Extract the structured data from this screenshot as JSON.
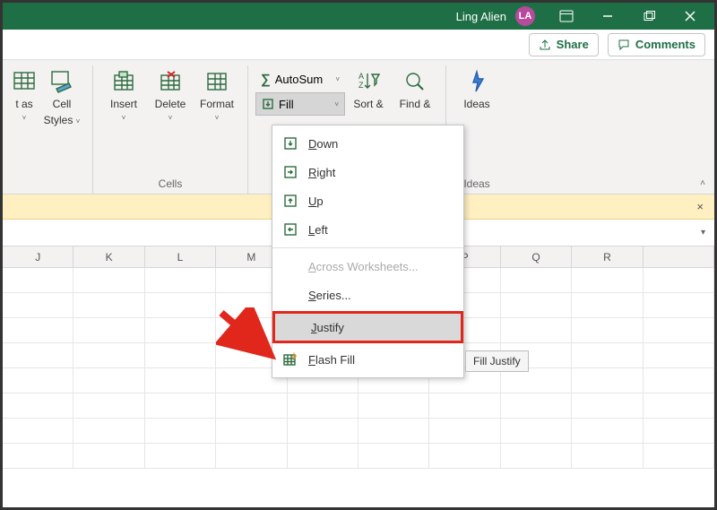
{
  "title": {
    "user_name": "Ling Alien",
    "user_initials": "LA"
  },
  "sharebar": {
    "share": "Share",
    "comments": "Comments"
  },
  "ribbon": {
    "format_as": {
      "line1": "t as",
      "caret": "˅"
    },
    "cell_styles": {
      "line1": "Cell",
      "line2": "Styles",
      "caret": "˅"
    },
    "insert": {
      "label": "Insert",
      "caret": "˅"
    },
    "delete": {
      "label": "Delete",
      "caret": "˅"
    },
    "format": {
      "label": "Format",
      "caret": "˅"
    },
    "cells_group": "Cells",
    "autosum": "AutoSum",
    "fill": "Fill",
    "sort": {
      "line1": "Sort &"
    },
    "find": {
      "line1": "Find &"
    },
    "ideas": "Ideas",
    "ideas_group": "Ideas"
  },
  "menu": {
    "down": "Down",
    "right": "Right",
    "up": "Up",
    "left": "Left",
    "across": "Across Worksheets...",
    "series": "Series...",
    "justify": "Justify",
    "flash": "Flash Fill"
  },
  "tooltip": "Fill Justify",
  "columns": [
    "J",
    "K",
    "L",
    "M",
    "",
    "",
    "P",
    "Q",
    "R",
    ""
  ],
  "row_count": 8,
  "msgbar_close": "×"
}
